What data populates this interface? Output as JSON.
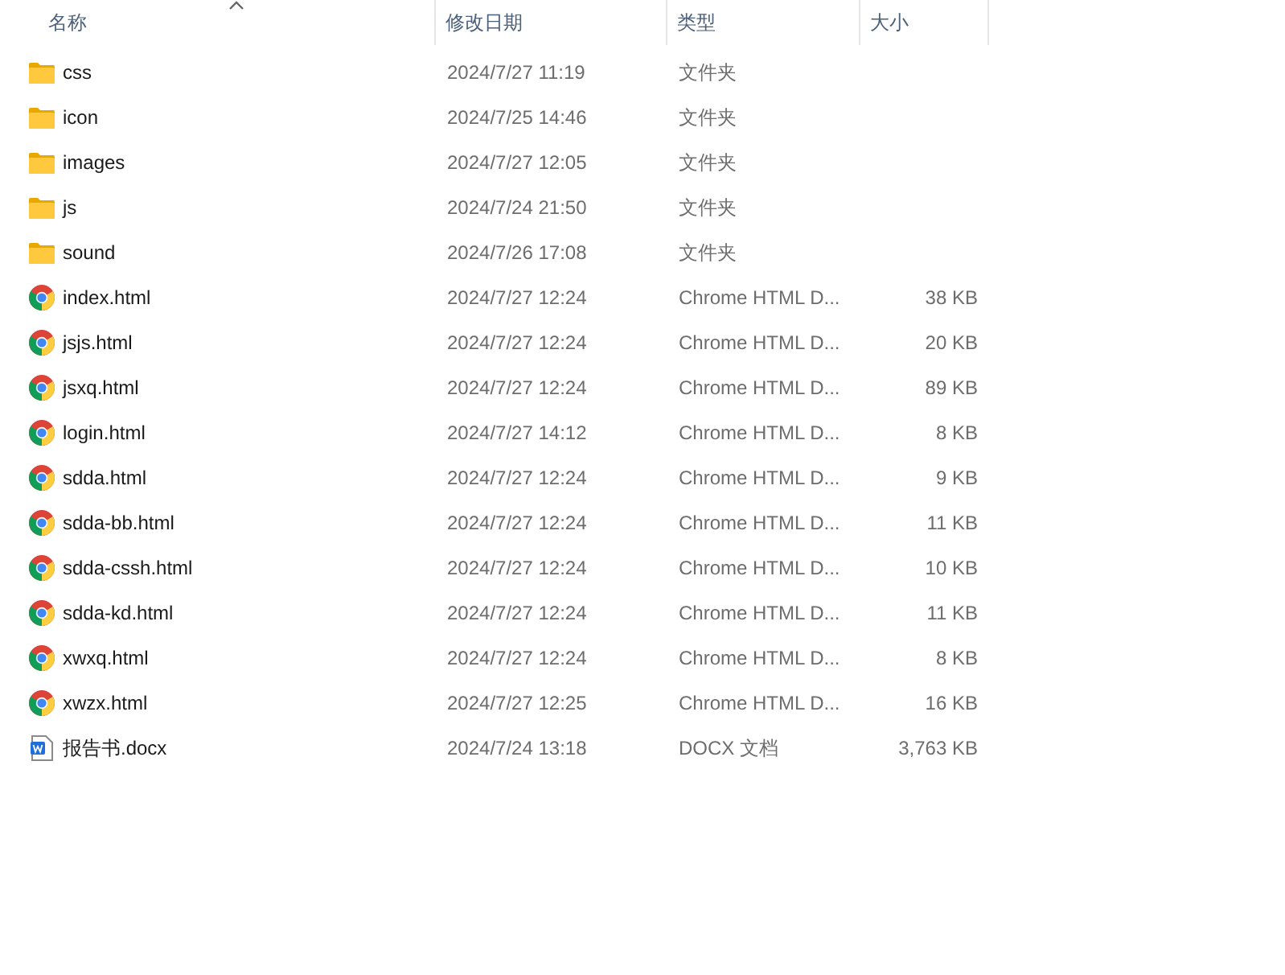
{
  "columns": [
    {
      "label": "名称",
      "sorted": true
    },
    {
      "label": "修改日期",
      "sorted": false
    },
    {
      "label": "类型",
      "sorted": false
    },
    {
      "label": "大小",
      "sorted": false
    }
  ],
  "rows": [
    {
      "kind": "folder",
      "name": "css",
      "date": "2024/7/27 11:19",
      "type": "文件夹"
    },
    {
      "kind": "folder",
      "name": "icon",
      "date": "2024/7/25 14:46",
      "type": "文件夹"
    },
    {
      "kind": "folder",
      "name": "images",
      "date": "2024/7/27 12:05",
      "type": "文件夹"
    },
    {
      "kind": "folder",
      "name": "js",
      "date": "2024/7/24 21:50",
      "type": "文件夹"
    },
    {
      "kind": "folder",
      "name": "sound",
      "date": "2024/7/26 17:08",
      "type": "文件夹"
    },
    {
      "kind": "chrome",
      "name": "index.html",
      "date": "2024/7/27 12:24",
      "type": "Chrome HTML D...",
      "size": "38 KB"
    },
    {
      "kind": "chrome",
      "name": "jsjs.html",
      "date": "2024/7/27 12:24",
      "type": "Chrome HTML D...",
      "size": "20 KB"
    },
    {
      "kind": "chrome",
      "name": "jsxq.html",
      "date": "2024/7/27 12:24",
      "type": "Chrome HTML D...",
      "size": "89 KB"
    },
    {
      "kind": "chrome",
      "name": "login.html",
      "date": "2024/7/27 14:12",
      "type": "Chrome HTML D...",
      "size": "8 KB"
    },
    {
      "kind": "chrome",
      "name": "sdda.html",
      "date": "2024/7/27 12:24",
      "type": "Chrome HTML D...",
      "size": "9 KB"
    },
    {
      "kind": "chrome",
      "name": "sdda-bb.html",
      "date": "2024/7/27 12:24",
      "type": "Chrome HTML D...",
      "size": "11 KB"
    },
    {
      "kind": "chrome",
      "name": "sdda-cssh.html",
      "date": "2024/7/27 12:24",
      "type": "Chrome HTML D...",
      "size": "10 KB"
    },
    {
      "kind": "chrome",
      "name": "sdda-kd.html",
      "date": "2024/7/27 12:24",
      "type": "Chrome HTML D...",
      "size": "11 KB"
    },
    {
      "kind": "chrome",
      "name": "xwxq.html",
      "date": "2024/7/27 12:24",
      "type": "Chrome HTML D...",
      "size": "8 KB"
    },
    {
      "kind": "chrome",
      "name": "xwzx.html",
      "date": "2024/7/27 12:25",
      "type": "Chrome HTML D...",
      "size": "16 KB"
    },
    {
      "kind": "word",
      "name": "报告书.docx",
      "date": "2024/7/24 13:18",
      "type": "DOCX 文档",
      "size": "3,763 KB"
    }
  ]
}
